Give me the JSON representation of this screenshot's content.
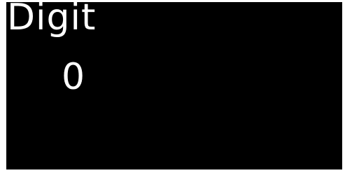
{
  "display": {
    "title": "Digit",
    "value": "0",
    "background_color": "#000000",
    "text_color": "#ffffff"
  }
}
